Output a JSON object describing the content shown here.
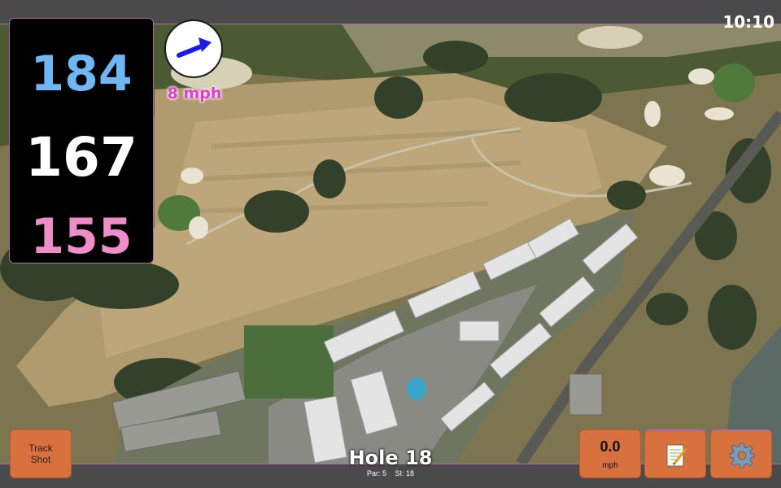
{
  "status_bar": {
    "time": "10:10"
  },
  "distances": {
    "back": "184",
    "middle": "167",
    "front": "155"
  },
  "wind": {
    "speed_label": "8 mph",
    "direction_icon": "arrow-icon",
    "arrow_color": "#1a1aee"
  },
  "hole": {
    "title": "Hole 18",
    "par_label": "Par: 5",
    "si_label": "SI: 18"
  },
  "buttons": {
    "track_shot_line1": "Track",
    "track_shot_line2": "Shot",
    "speed_value": "0.0",
    "speed_unit": "mph",
    "notes_icon": "notepad-icon",
    "settings_icon": "gear-icon"
  },
  "colors": {
    "back_distance": "#6fb6f5",
    "middle_distance": "#ffffff",
    "front_distance": "#f08cc8",
    "wind_text": "#e33ad0",
    "button_bg": "#d9713e",
    "accent_border": "#b06aa6"
  }
}
